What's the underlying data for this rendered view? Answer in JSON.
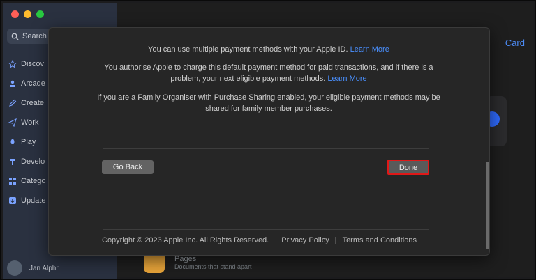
{
  "sidebar": {
    "search_label": "Search",
    "items": [
      {
        "label": "Discov",
        "icon": "star-icon"
      },
      {
        "label": "Arcade",
        "icon": "joystick-icon"
      },
      {
        "label": "Create",
        "icon": "pencil-icon"
      },
      {
        "label": "Work",
        "icon": "paper-plane-icon"
      },
      {
        "label": "Play",
        "icon": "rocket-icon"
      },
      {
        "label": "Develo",
        "icon": "hammer-icon"
      },
      {
        "label": "Catego",
        "icon": "grid-icon"
      },
      {
        "label": "Update",
        "icon": "arrow-down-icon"
      }
    ],
    "user_name": "Jan Alphr"
  },
  "background": {
    "card_link": "Card",
    "app_title": "Pages",
    "app_subtitle": "Documents that stand apart"
  },
  "modal": {
    "para1_text": "You can use multiple payment methods with your Apple ID.",
    "para1_link": "Learn More",
    "para2_text": "You authorise Apple to charge this default payment method for paid transactions, and if there is a problem, your next eligible payment methods.",
    "para2_link": "Learn More",
    "para3_text": "If you are a Family Organiser with Purchase Sharing enabled, your eligible payment methods may be shared for family member purchases.",
    "go_back_label": "Go Back",
    "done_label": "Done",
    "copyright": "Copyright © 2023 Apple Inc. All Rights Reserved.",
    "privacy_policy": "Privacy Policy",
    "footer_separator": "|",
    "terms": "Terms and Conditions"
  },
  "colors": {
    "link": "#4a90ff",
    "highlight": "#e01818"
  }
}
